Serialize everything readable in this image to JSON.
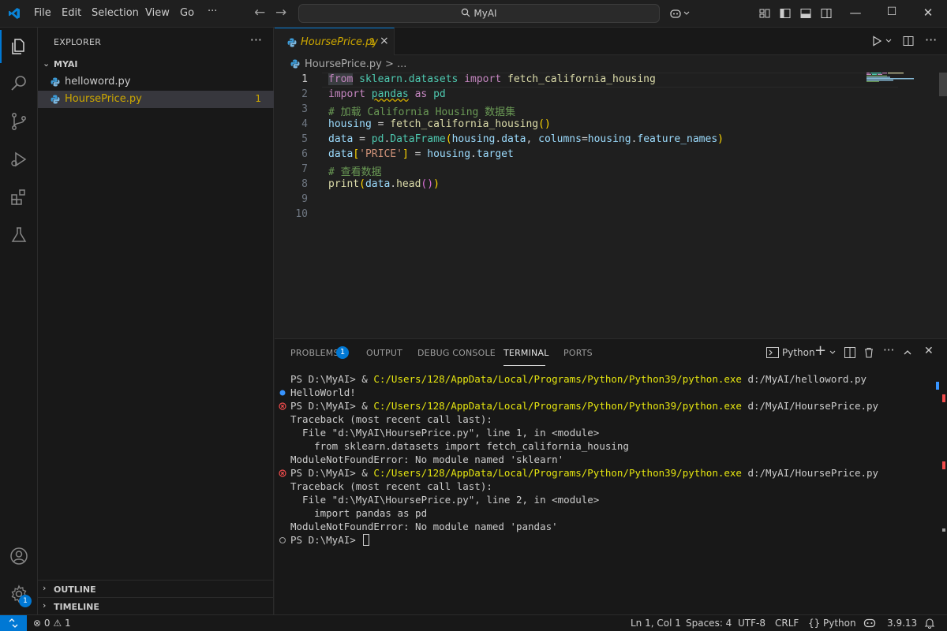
{
  "titlebar": {
    "menu": [
      "File",
      "Edit",
      "Selection",
      "View",
      "Go",
      "···"
    ],
    "search_text": "MyAI"
  },
  "sidebar": {
    "title": "EXPLORER",
    "more": "···",
    "folder": "MYAI",
    "files": [
      {
        "name": "helloword.py",
        "problems": ""
      },
      {
        "name": "HoursePrice.py",
        "problems": "1"
      }
    ],
    "sections": [
      "OUTLINE",
      "TIMELINE"
    ]
  },
  "activity": {
    "settings_badge": "1"
  },
  "editor": {
    "tab": {
      "name": "HoursePrice.py",
      "problems": "1",
      "close": "×"
    },
    "breadcrumb": "HoursePrice.py > ...",
    "line_numbers": [
      "1",
      "2",
      "3",
      "4",
      "5",
      "6",
      "7",
      "8",
      "9",
      "10"
    ],
    "active_line": 1,
    "code": {
      "l1": {
        "kw1": "from",
        "mod": "sklearn.datasets",
        "kw2": "import",
        "fn": "fetch_california_housing"
      },
      "l2": {
        "kw1": "import",
        "mod": "pandas",
        "kw2": "as",
        "alias": "pd"
      },
      "l3": "# 加载 California Housing 数据集",
      "l4": {
        "var": "housing",
        "op": " = ",
        "fn": "fetch_california_housing",
        "args": "()"
      },
      "l5": {
        "var": "data",
        "op": " = ",
        "mod": "pd",
        "cls": "DataFrame",
        "a1": "housing",
        "a1b": "data",
        "kw": "columns",
        "a2": "housing",
        "a2b": "feature_names"
      },
      "l6": {
        "var": "data",
        "str": "'PRICE'",
        "op": " = ",
        "a": "housing",
        "b": "target"
      },
      "l7": "# 查看数据",
      "l8": {
        "fn": "print",
        "var": "data",
        "method": "head"
      }
    }
  },
  "panel": {
    "tabs": [
      "PROBLEMS",
      "OUTPUT",
      "DEBUG CONSOLE",
      "TERMINAL",
      "PORTS"
    ],
    "active_tab": "TERMINAL",
    "problems_badge": "1",
    "shell": "Python",
    "terminal": [
      {
        "prompt": "PS D:\\MyAI> & ",
        "exe": "C:/Users/128/AppData/Local/Programs/Python/Python39/python.exe",
        "arg": " d:/MyAI/helloword.py",
        "mark": ""
      },
      {
        "text": "HelloWorld!",
        "mark": "info"
      },
      {
        "prompt": "PS D:\\MyAI> & ",
        "exe": "C:/Users/128/AppData/Local/Programs/Python/Python39/python.exe",
        "arg": " d:/MyAI/HoursePrice.py",
        "mark": "error"
      },
      {
        "text": "Traceback (most recent call last):",
        "mark": ""
      },
      {
        "text": "  File \"d:\\MyAI\\HoursePrice.py\", line 1, in <module>",
        "mark": ""
      },
      {
        "text": "    from sklearn.datasets import fetch_california_housing",
        "mark": ""
      },
      {
        "text": "ModuleNotFoundError: No module named 'sklearn'",
        "mark": ""
      },
      {
        "prompt": "PS D:\\MyAI> & ",
        "exe": "C:/Users/128/AppData/Local/Programs/Python/Python39/python.exe",
        "arg": " d:/MyAI/HoursePrice.py",
        "mark": "error"
      },
      {
        "text": "Traceback (most recent call last):",
        "mark": ""
      },
      {
        "text": "  File \"d:\\MyAI\\HoursePrice.py\", line 2, in <module>",
        "mark": ""
      },
      {
        "text": "    import pandas as pd",
        "mark": ""
      },
      {
        "text": "ModuleNotFoundError: No module named 'pandas'",
        "mark": ""
      },
      {
        "text": "PS D:\\MyAI> ",
        "mark": "idle",
        "cursor": true
      }
    ]
  },
  "statusbar": {
    "errors": "0",
    "warnings": "1",
    "position": "Ln 1, Col 1",
    "spaces": "Spaces: 4",
    "encoding": "UTF-8",
    "eol": "CRLF",
    "braces": "{}",
    "language": "Python",
    "version": "3.9.13"
  },
  "colors": {
    "accent": "#0078d4",
    "warning": "#cca700",
    "error": "#f14c4c",
    "terminal_path": "#e5e510"
  }
}
